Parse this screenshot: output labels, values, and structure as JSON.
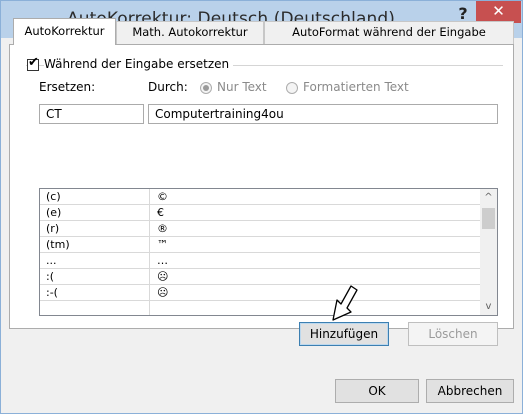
{
  "window": {
    "title": "AutoKorrektur: Deutsch (Deutschland)",
    "help": "?",
    "close": "✕"
  },
  "tabs": [
    {
      "label": "AutoKorrektur",
      "active": true
    },
    {
      "label": "Math. Autokorrektur",
      "active": false
    },
    {
      "label": "AutoFormat während der Eingabe",
      "active": false
    }
  ],
  "replace_group": {
    "checkbox_label": "Während der Eingabe ersetzen",
    "checked": true,
    "ersetzen_label": "Ersetzen:",
    "durch_label": "Durch:",
    "radio_plain": "Nur Text",
    "radio_formatted": "Formatierten Text",
    "ersetzen_value": "CT",
    "durch_value": "Computertraining4ou"
  },
  "entries": [
    {
      "from": "(c)",
      "to": "©"
    },
    {
      "from": "(e)",
      "to": "€"
    },
    {
      "from": "(r)",
      "to": "®"
    },
    {
      "from": "(tm)",
      "to": "™"
    },
    {
      "from": "...",
      "to": "…"
    },
    {
      "from": ":(",
      "to": "☹"
    },
    {
      "from": ":-(",
      "to": "☹"
    }
  ],
  "buttons": {
    "add": "Hinzufügen",
    "delete": "Löschen",
    "ok": "OK",
    "cancel": "Abbrechen"
  },
  "icons": {
    "scroll_up": "^",
    "scroll_down": "v"
  }
}
